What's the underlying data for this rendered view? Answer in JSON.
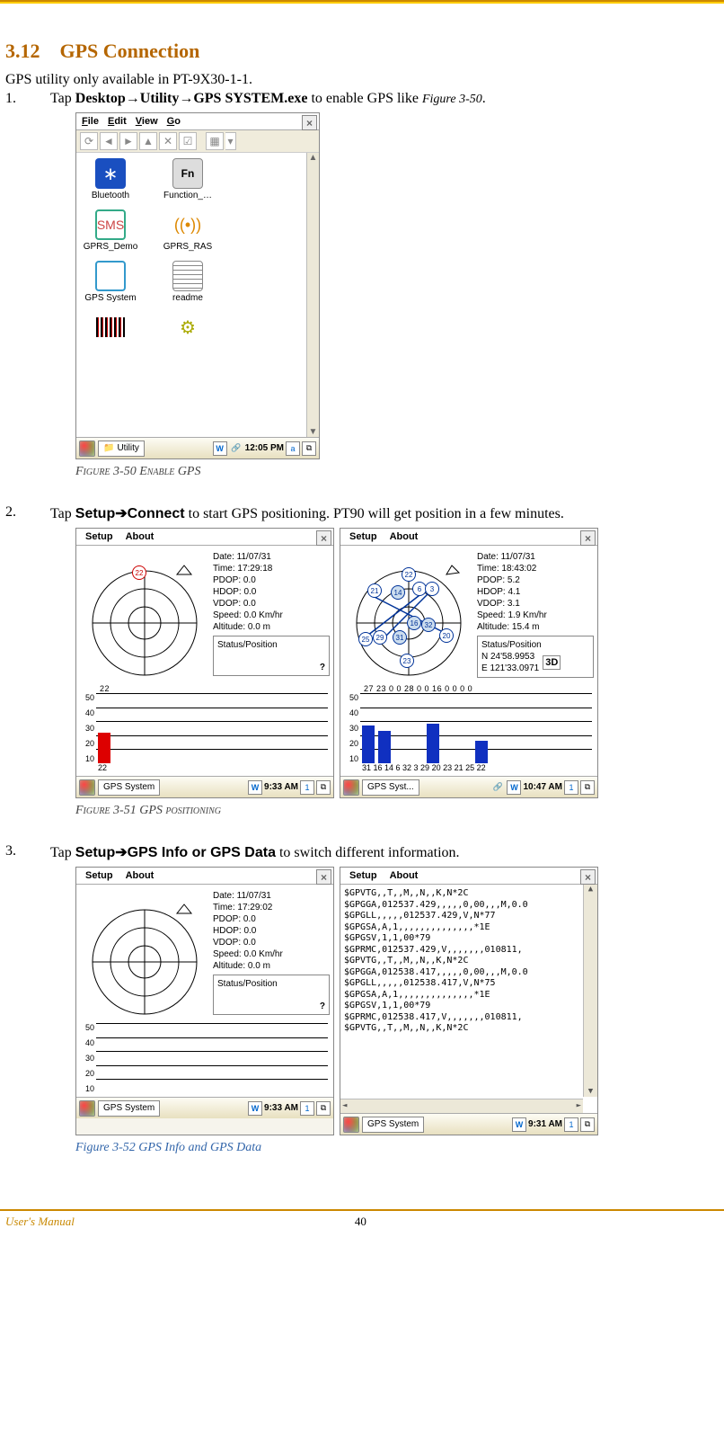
{
  "section": {
    "number": "3.12",
    "title": "GPS Connection"
  },
  "intro": "GPS utility only available in PT-9X30-1-1.",
  "step1": {
    "num": "1.",
    "prefix": "Tap ",
    "path": "Desktop→Utility→GPS SYSTEM.exe",
    "suffix": " to enable GPS like ",
    "figref": "Figure 3-50",
    "tail": "."
  },
  "fig50": {
    "caption": "Figure 3-50 Enable GPS",
    "menus": [
      "File",
      "Edit",
      "View",
      "Go"
    ],
    "toolbar_glyphs": [
      "⟳",
      "◄",
      "►",
      "▲",
      "✕",
      "☑",
      "▦",
      "▾"
    ],
    "icons": [
      {
        "name": "bluetooth-icon",
        "label": "Bluetooth",
        "glyph": "✱"
      },
      {
        "name": "function-icon",
        "label": "Function_…",
        "glyph": "Fn"
      },
      {
        "name": "gprs-demo-icon",
        "label": "GPRS_Demo",
        "glyph": "✉"
      },
      {
        "name": "gprs-ras-icon",
        "label": "GPRS_RAS",
        "glyph": "📡"
      },
      {
        "name": "gps-system-icon",
        "label": "GPS System",
        "glyph": ""
      },
      {
        "name": "readme-icon",
        "label": "readme",
        "glyph": ""
      },
      {
        "name": "barcode-icon",
        "label": "",
        "glyph": ""
      },
      {
        "name": "gear-icon",
        "label": "",
        "glyph": "⚙"
      }
    ],
    "taskbar": {
      "app": "Utility",
      "time": "12:05 PM",
      "left_tray": "W",
      "right_tray1": "a",
      "right_tray2": "⧉"
    }
  },
  "step2": {
    "num": "2.",
    "prefix": "Tap ",
    "path": "Setup➔Connect",
    "suffix": " to start GPS positioning. PT90 will get position in a few minutes."
  },
  "fig51": {
    "caption": "Figure 3-51 GPS positioning",
    "menus": [
      "Setup",
      "About"
    ],
    "left": {
      "date": "Date: 11/07/31",
      "time": "Time: 17:29:18",
      "pdop": "PDOP: 0.0",
      "hdop": "HDOP: 0.0",
      "vdop": "VDOP: 0.0",
      "speed": "Speed: 0.0 Km/hr",
      "alt": "Altitude: 0.0 m",
      "status_title": "Status/Position",
      "status_mark": "?",
      "top_nums": "22",
      "bot_nums": "22",
      "taskbar": {
        "app": "GPS System",
        "time": "9:33 AM",
        "left_tray": "W",
        "right1": "1",
        "right2": "⧉"
      }
    },
    "right": {
      "date": "Date: 11/07/31",
      "time": "Time: 18:43:02",
      "pdop": "PDOP: 5.2",
      "hdop": "HDOP: 4.1",
      "vdop": "VDOP: 3.1",
      "speed": "Speed: 1.9 Km/hr",
      "alt": "Altitude: 15.4 m",
      "status_title": "Status/Position",
      "pos1": "N 24'58.9953",
      "pos2": "E 121'33.0971",
      "mode3d": "3D",
      "top_nums": "27 23  0  0  28  0   0  16  0   0   0   0",
      "bot_nums": "31 16 14  6 32  3 29 20 23 21 25 22",
      "taskbar": {
        "app": "GPS Syst...",
        "time": "10:47 AM",
        "left_tray": "W",
        "right1": "1",
        "right2": "⧉"
      }
    }
  },
  "step3": {
    "num": "3.",
    "prefix": "Tap ",
    "path": "Setup➔GPS Info or GPS Data",
    "suffix": " to switch different information."
  },
  "fig52": {
    "caption": "Figure 3-52 GPS Info and GPS Data",
    "menus": [
      "Setup",
      "About"
    ],
    "left": {
      "date": "Date: 11/07/31",
      "time": "Time: 17:29:02",
      "pdop": "PDOP: 0.0",
      "hdop": "HDOP: 0.0",
      "vdop": "VDOP: 0.0",
      "speed": "Speed: 0.0 Km/hr",
      "alt": "Altitude: 0.0 m",
      "status_title": "Status/Position",
      "status_mark": "?",
      "taskbar": {
        "app": "GPS System",
        "time": "9:33 AM",
        "left_tray": "W",
        "right1": "1",
        "right2": "⧉"
      }
    },
    "right": {
      "nmea": [
        "$GPVTG,,T,,M,,N,,K,N*2C",
        "$GPGGA,012537.429,,,,,0,00,,,M,0.0",
        "$GPGLL,,,,,012537.429,V,N*77",
        "$GPGSA,A,1,,,,,,,,,,,,,,*1E",
        "$GPGSV,1,1,00*79",
        "$GPRMC,012537.429,V,,,,,,,010811,",
        "$GPVTG,,T,,M,,N,,K,N*2C",
        "$GPGGA,012538.417,,,,,0,00,,,M,0.0",
        "$GPGLL,,,,,012538.417,V,N*75",
        "$GPGSA,A,1,,,,,,,,,,,,,,*1E",
        "$GPGSV,1,1,00*79",
        "$GPRMC,012538.417,V,,,,,,,010811,",
        "$GPVTG,,T,,M,,N,,K,N*2C"
      ],
      "taskbar": {
        "app": "GPS System",
        "time": "9:31 AM",
        "left_tray": "W",
        "right1": "1",
        "right2": "⧉"
      }
    }
  },
  "footer": {
    "left": "User's Manual",
    "page": "40"
  },
  "chart_data": [
    {
      "type": "bar",
      "title": "Satellite signal (Figure 3-51 left)",
      "categories": [
        "22"
      ],
      "values": [
        22
      ],
      "ylim": [
        0,
        50
      ],
      "ylabel": "",
      "xlabel": ""
    },
    {
      "type": "bar",
      "title": "Satellite signal (Figure 3-51 right)",
      "categories": [
        "31",
        "16",
        "14",
        "6",
        "32",
        "3",
        "29",
        "20",
        "23",
        "21",
        "25",
        "22"
      ],
      "values": [
        27,
        23,
        0,
        0,
        28,
        0,
        0,
        16,
        0,
        0,
        0,
        0
      ],
      "ylim": [
        0,
        50
      ],
      "ylabel": "",
      "xlabel": ""
    }
  ]
}
